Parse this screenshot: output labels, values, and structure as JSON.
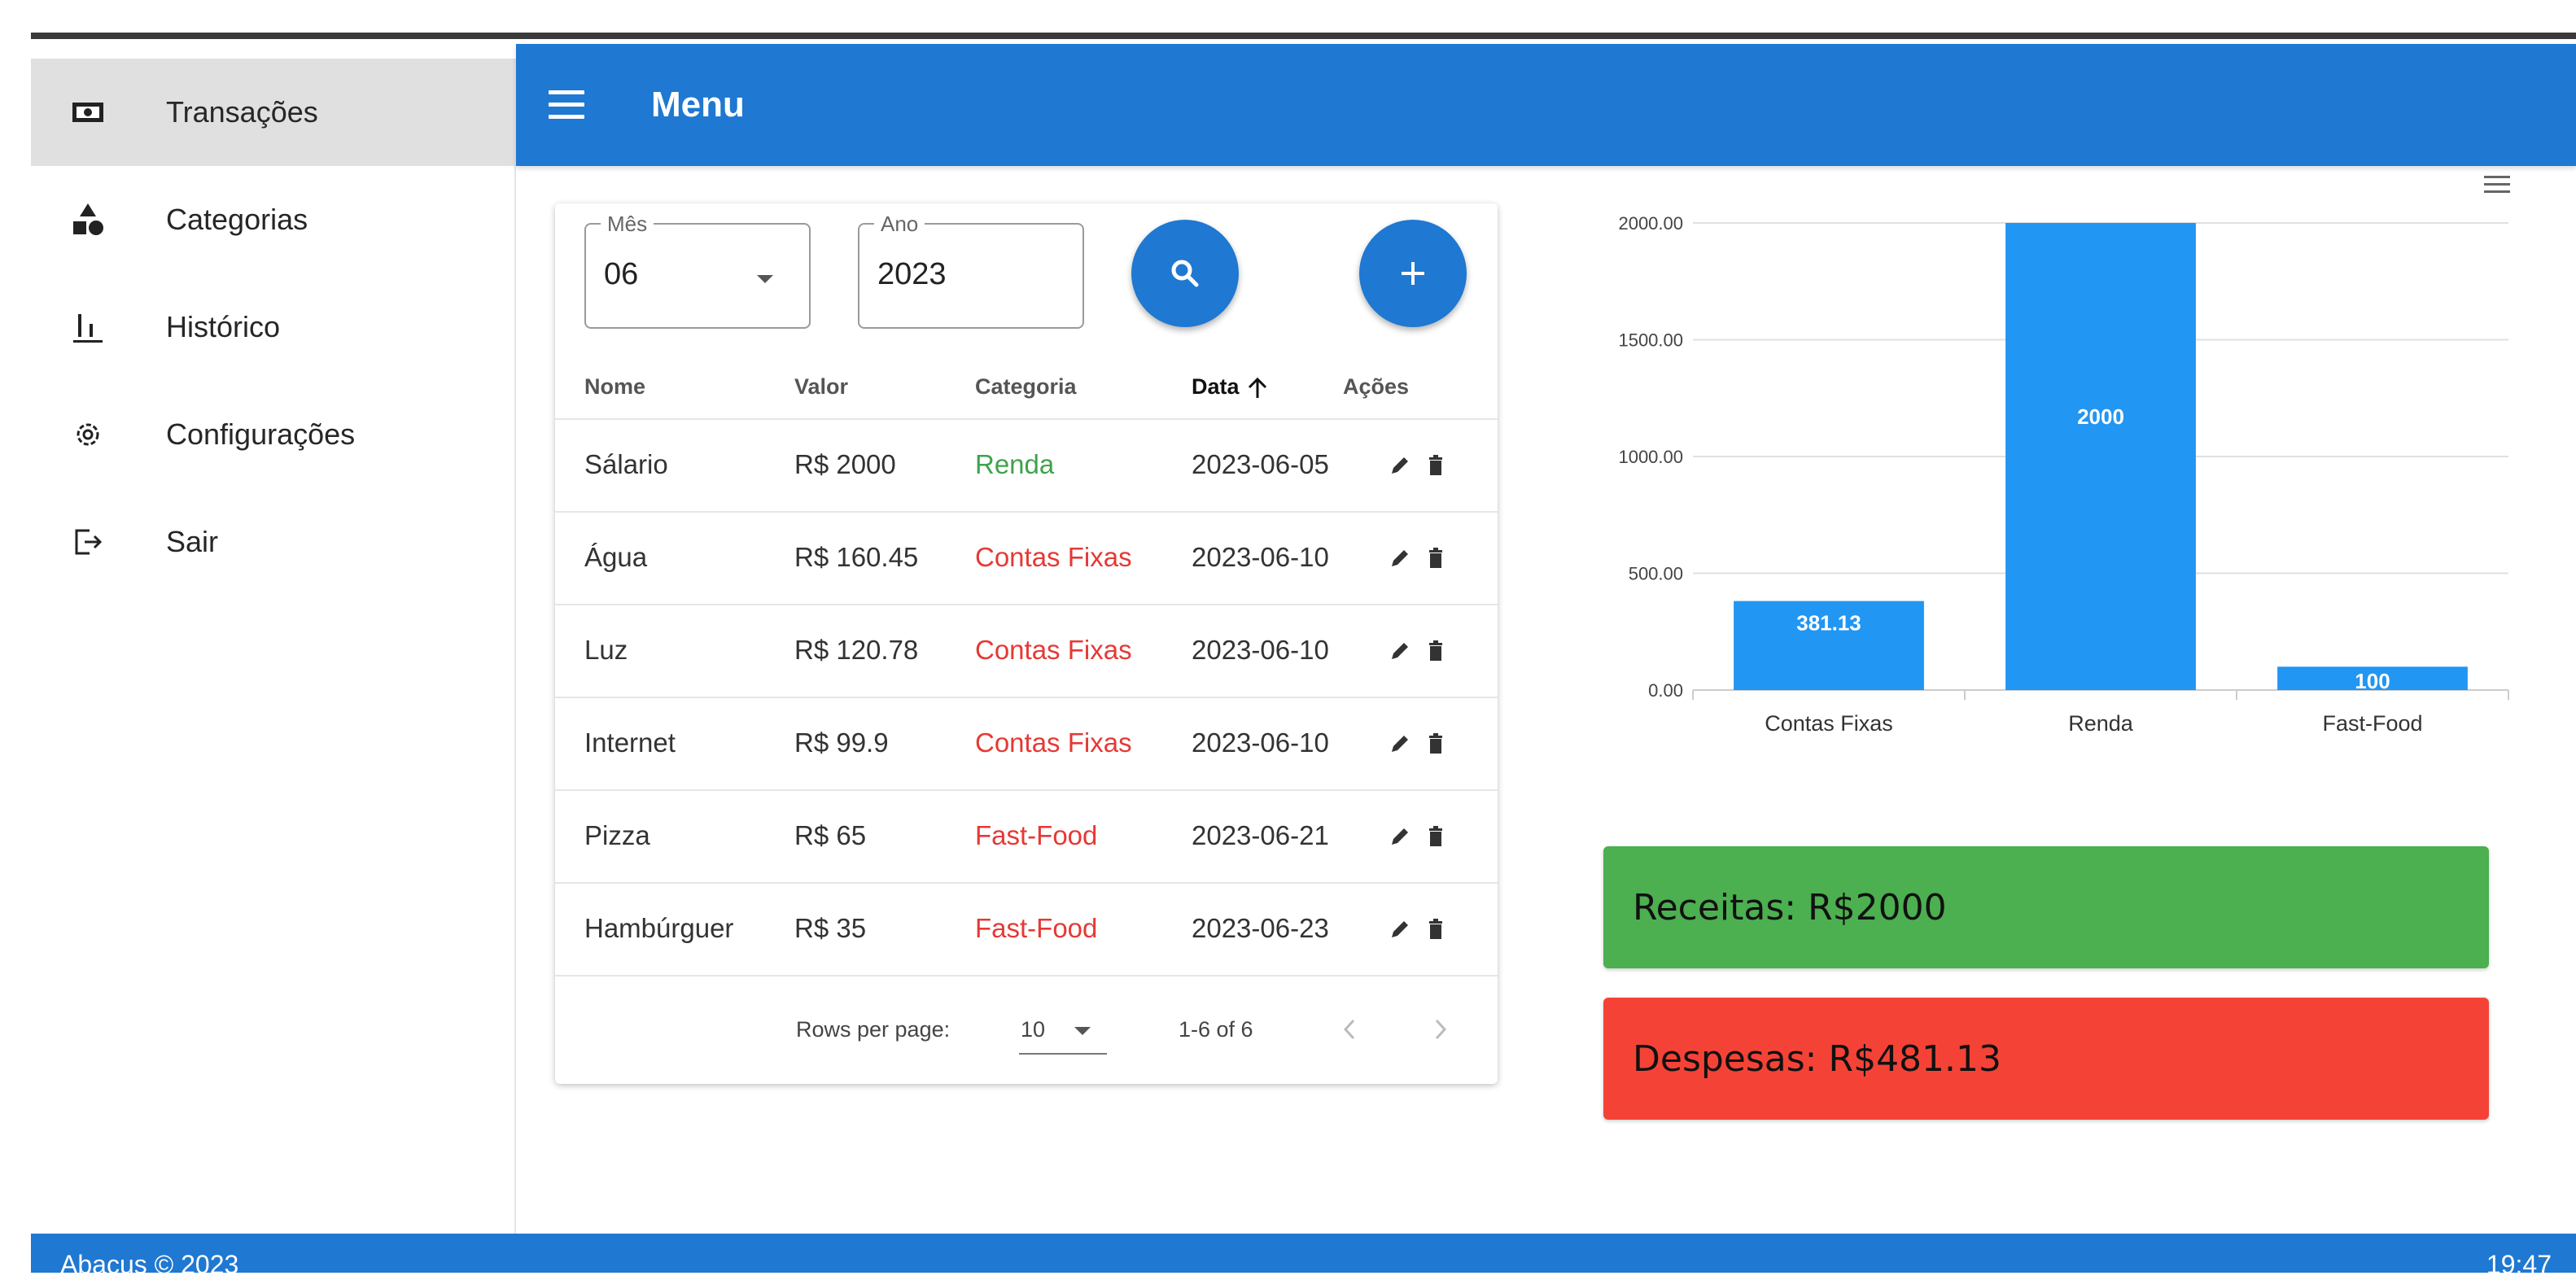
{
  "sidebar": {
    "items": [
      {
        "label": "Transações",
        "icon": "money-icon",
        "active": true
      },
      {
        "label": "Categorias",
        "icon": "category-icon"
      },
      {
        "label": "Histórico",
        "icon": "bar-chart-icon"
      },
      {
        "label": "Configurações",
        "icon": "gear-icon"
      },
      {
        "label": "Sair",
        "icon": "logout-icon"
      }
    ]
  },
  "appbar": {
    "title": "Menu"
  },
  "filters": {
    "month_label": "Mês",
    "month_value": "06",
    "year_label": "Ano",
    "year_value": "2023"
  },
  "table": {
    "headers": [
      "Nome",
      "Valor",
      "Categoria",
      "Data",
      "Ações"
    ],
    "sort_column": "Data",
    "rows": [
      {
        "nome": "Sálario",
        "valor": "R$ 2000",
        "categoria": "Renda",
        "data": "2023-06-05",
        "tipo": "receita"
      },
      {
        "nome": "Água",
        "valor": "R$ 160.45",
        "categoria": "Contas Fixas",
        "data": "2023-06-10",
        "tipo": "despesa"
      },
      {
        "nome": "Luz",
        "valor": "R$ 120.78",
        "categoria": "Contas Fixas",
        "data": "2023-06-10",
        "tipo": "despesa"
      },
      {
        "nome": "Internet",
        "valor": "R$ 99.9",
        "categoria": "Contas Fixas",
        "data": "2023-06-10",
        "tipo": "despesa"
      },
      {
        "nome": "Pizza",
        "valor": "R$ 65",
        "categoria": "Fast-Food",
        "data": "2023-06-21",
        "tipo": "despesa"
      },
      {
        "nome": "Hambúrguer",
        "valor": "R$ 35",
        "categoria": "Fast-Food",
        "data": "2023-06-23",
        "tipo": "despesa"
      }
    ],
    "pagination": {
      "rows_per_page_label": "Rows per page:",
      "rows_per_page": "10",
      "range": "1-6 of 6"
    }
  },
  "chart_data": {
    "type": "bar",
    "categories": [
      "Contas Fixas",
      "Renda",
      "Fast-Food"
    ],
    "values": [
      381.13,
      2000,
      100
    ],
    "data_labels": [
      "381.13",
      "2000",
      "100"
    ],
    "y_ticks": [
      "0.00",
      "500.00",
      "1000.00",
      "1500.00",
      "2000.00"
    ],
    "ylim": [
      0,
      2000
    ],
    "grid": true,
    "bar_color": "#2196f3",
    "title": "",
    "xlabel": "",
    "ylabel": ""
  },
  "summary": {
    "income": "Receitas: R$2000",
    "expense": "Despesas: R$481.13",
    "income_color": "#4caf50",
    "expense_color": "#f44336"
  },
  "footer": {
    "left": "Abacus © 2023",
    "right": "19:47"
  },
  "colors": {
    "primary": "#1f78d1",
    "green_text": "#3fa34d",
    "red_text": "#e53935"
  }
}
